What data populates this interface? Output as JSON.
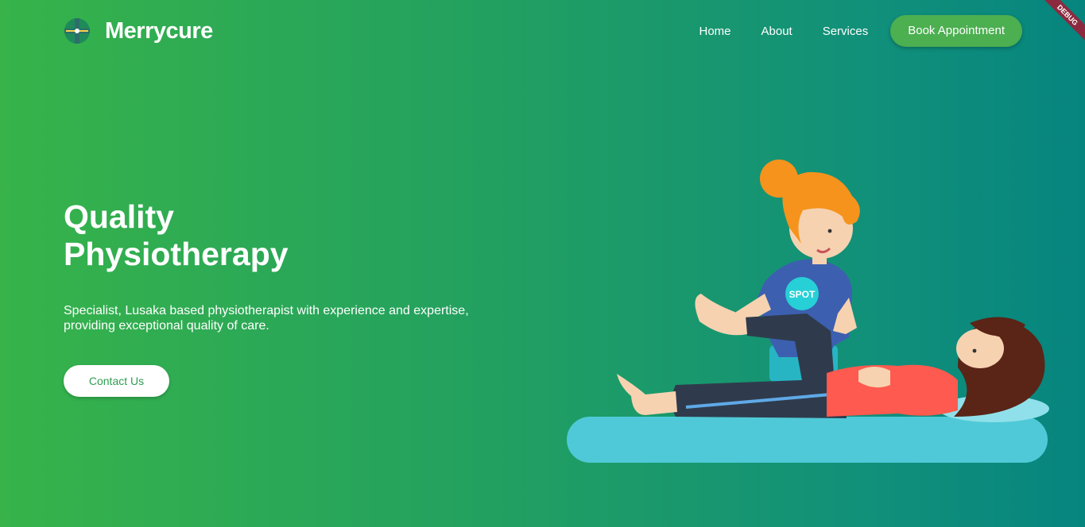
{
  "header": {
    "brand": "Merrycure",
    "nav": [
      "Home",
      "About",
      "Services"
    ],
    "cta": "Book Appointment"
  },
  "debug_ribbon": "DEBUG",
  "hero": {
    "title_line1": "Quality",
    "title_line2": "Physiotherapy",
    "subtitle_line1": "Specialist, Lusaka based physiotherapist with experience and expertise,",
    "subtitle_line2": "providing exceptional quality of care.",
    "contact": "Contact Us"
  },
  "illustration": {
    "shirt_badge": "SPOT"
  },
  "colors": {
    "accent": "#4caf50",
    "gradient_start": "#37b34a",
    "gradient_end": "#06857f"
  }
}
